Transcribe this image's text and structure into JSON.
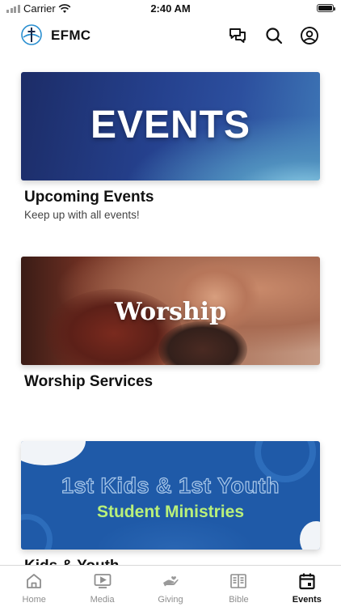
{
  "status_bar": {
    "carrier": "Carrier",
    "time": "2:40 AM"
  },
  "header": {
    "title": "EFMC",
    "icons": [
      "logo-icon",
      "chat-icon",
      "search-icon",
      "profile-icon"
    ]
  },
  "cards": [
    {
      "banner_text": "EVENTS",
      "title": "Upcoming Events",
      "subtitle": "Keep up with all events!"
    },
    {
      "banner_text": "Worship",
      "title": "Worship Services"
    },
    {
      "banner_text_1": "1st Kids & 1st Youth",
      "banner_text_2": "Student Ministries",
      "title": "Kids & Youth"
    }
  ],
  "tabs": [
    {
      "label": "Home",
      "icon": "home-icon"
    },
    {
      "label": "Media",
      "icon": "media-icon"
    },
    {
      "label": "Giving",
      "icon": "giving-icon"
    },
    {
      "label": "Bible",
      "icon": "bible-icon"
    },
    {
      "label": "Events",
      "icon": "calendar-icon",
      "active": true
    }
  ],
  "colors": {
    "accent_active": "#111111",
    "inactive": "#8e8e8e",
    "kids_banner": "#1f5aa8",
    "kids_subtitle": "#b9f07a"
  }
}
